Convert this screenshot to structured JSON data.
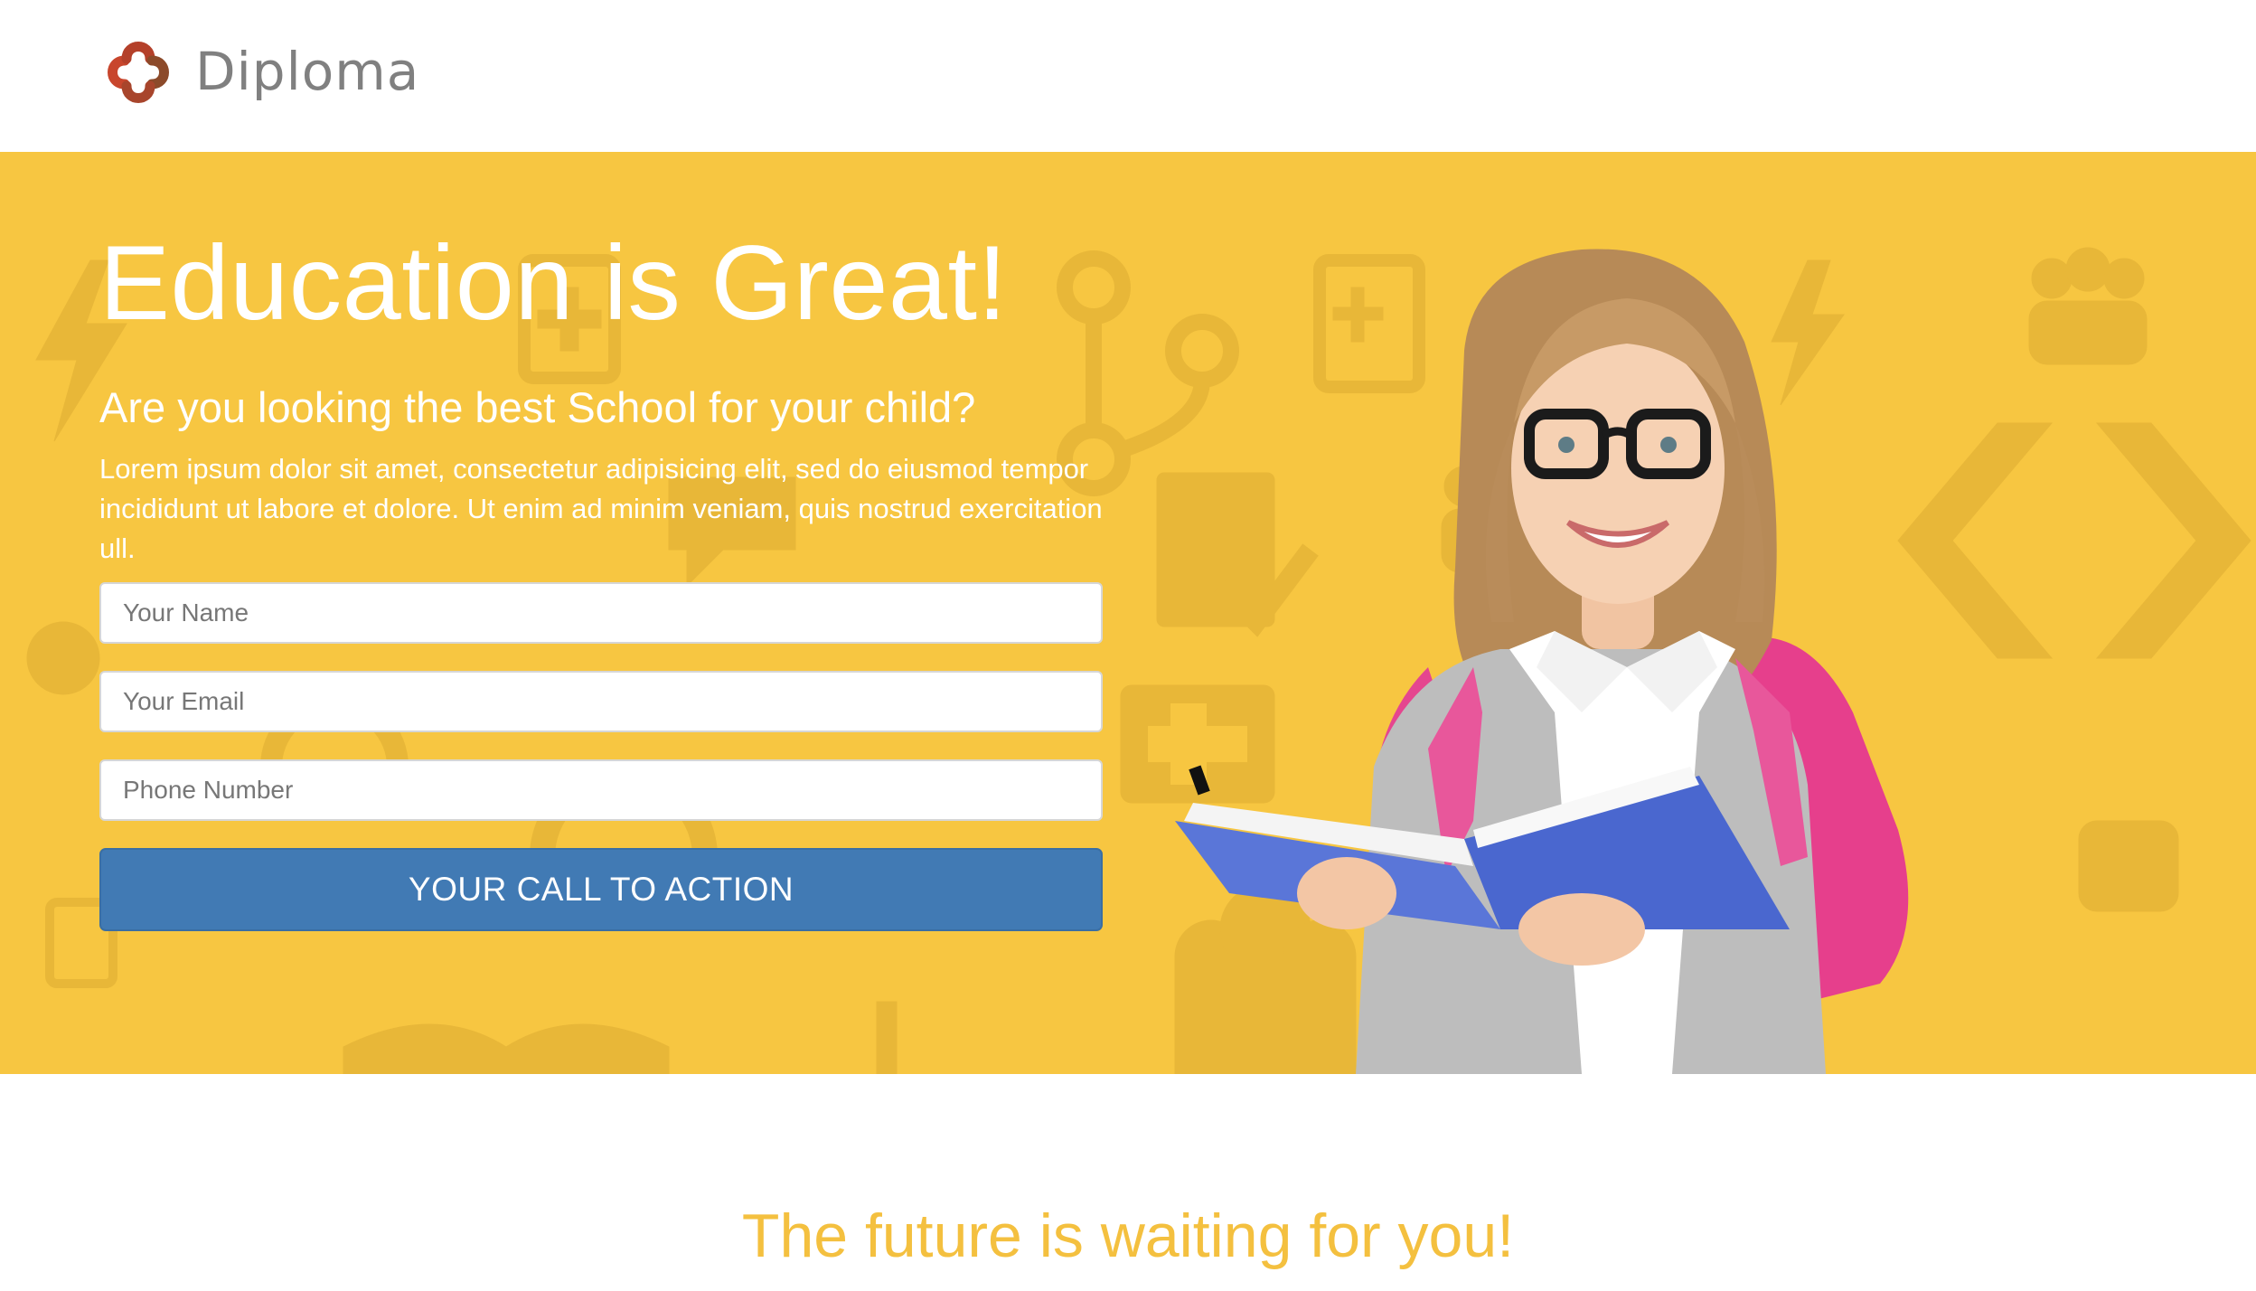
{
  "brand": {
    "name": "Diploma",
    "logo_icon": "diploma-logo-icon",
    "logo_colors": [
      "#c8462d",
      "#8c4a2a"
    ]
  },
  "hero": {
    "background_color": "#f7c641",
    "title": "Education is Great!",
    "subtitle": "Are you looking the best School for your child?",
    "description": "Lorem ipsum dolor sit amet, consectetur adipisicing elit, sed do eiusmod tempor incididunt ut labore et dolore. Ut enim ad minim veniam, quis nostrud exercitation ull.",
    "image": "student-girl-with-book-photo"
  },
  "form": {
    "name_placeholder": "Your Name",
    "email_placeholder": "Your Email",
    "phone_placeholder": "Phone Number",
    "cta_label": "YOUR CALL TO ACTION",
    "cta_color": "#417ab4"
  },
  "section": {
    "heading": "The future is waiting for you!",
    "heading_color": "#f4c03f"
  }
}
